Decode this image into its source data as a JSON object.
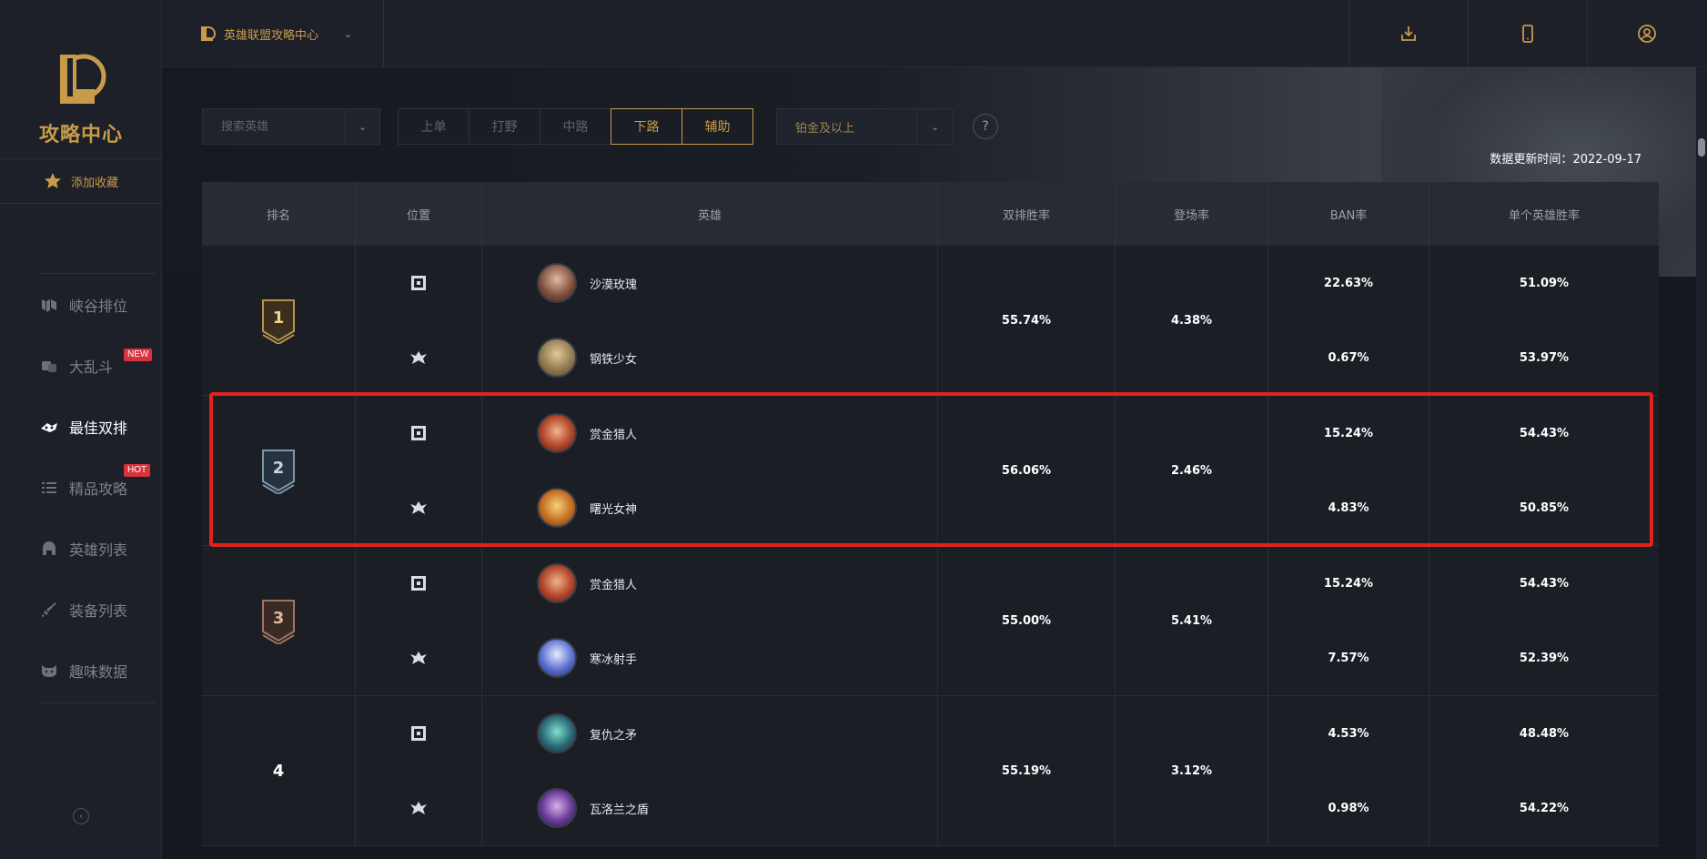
{
  "brand": {
    "logo_text": "攻略中心",
    "title": "英雄联盟攻略中心"
  },
  "sidebar": {
    "favorite_label": "添加收藏",
    "items": [
      {
        "label": "峡谷排位",
        "icon": "rank-icon"
      },
      {
        "label": "大乱斗",
        "icon": "aram-icon",
        "badge": "NEW"
      },
      {
        "label": "最佳双排",
        "icon": "duo-icon",
        "active": true
      },
      {
        "label": "精品攻略",
        "icon": "list-icon",
        "badge": "HOT"
      },
      {
        "label": "英雄列表",
        "icon": "helmet-icon"
      },
      {
        "label": "装备列表",
        "icon": "sword-icon"
      },
      {
        "label": "趣味数据",
        "icon": "cat-icon"
      }
    ]
  },
  "filters": {
    "search_placeholder": "搜索英雄",
    "positions": [
      "上单",
      "打野",
      "中路",
      "下路",
      "辅助"
    ],
    "tier": "铂金及以上",
    "help": "?",
    "update_label": "数据更新时间：",
    "update_date": "2022-09-17"
  },
  "table": {
    "headers": [
      "排名",
      "位置",
      "英雄",
      "双排胜率",
      "登场率",
      "BAN率",
      "单个英雄胜率"
    ],
    "rows": [
      {
        "rank": "1",
        "duo_winrate": "55.74%",
        "pick_rate": "4.38%",
        "heroes": [
          {
            "name": "沙漠玫瑰",
            "ban": "22.63%",
            "winrate": "51.09%"
          },
          {
            "name": "钢铁少女",
            "ban": "0.67%",
            "winrate": "53.97%"
          }
        ]
      },
      {
        "rank": "2",
        "duo_winrate": "56.06%",
        "pick_rate": "2.46%",
        "heroes": [
          {
            "name": "赏金猎人",
            "ban": "15.24%",
            "winrate": "54.43%"
          },
          {
            "name": "曙光女神",
            "ban": "4.83%",
            "winrate": "50.85%"
          }
        ]
      },
      {
        "rank": "3",
        "duo_winrate": "55.00%",
        "pick_rate": "5.41%",
        "heroes": [
          {
            "name": "赏金猎人",
            "ban": "15.24%",
            "winrate": "54.43%"
          },
          {
            "name": "寒冰射手",
            "ban": "7.57%",
            "winrate": "52.39%"
          }
        ]
      },
      {
        "rank": "4",
        "duo_winrate": "55.19%",
        "pick_rate": "3.12%",
        "heroes": [
          {
            "name": "复仇之矛",
            "ban": "4.53%",
            "winrate": "48.48%"
          },
          {
            "name": "瓦洛兰之盾",
            "ban": "0.98%",
            "winrate": "54.22%"
          }
        ]
      }
    ]
  },
  "colors": {
    "accent": "#c89b4a",
    "highlight": "#e0241c",
    "badge": "#d8323d"
  }
}
